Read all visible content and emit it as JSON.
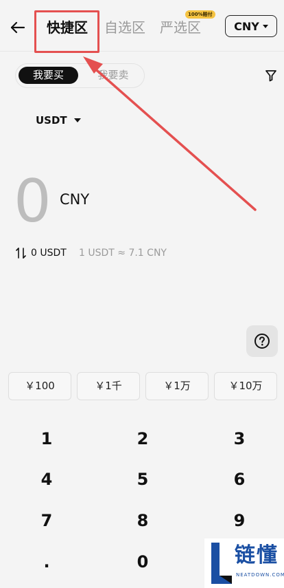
{
  "header": {
    "tabs": [
      {
        "label": "快捷区",
        "active": true
      },
      {
        "label": "自选区",
        "active": false
      },
      {
        "label": "严选区",
        "active": false,
        "badge": "100%赔付"
      }
    ],
    "currency": "CNY"
  },
  "trade_toggle": {
    "buy_label": "我要买",
    "sell_label": "我要卖",
    "selected": "buy"
  },
  "crypto": {
    "selected": "USDT"
  },
  "amount": {
    "value": "0",
    "unit": "CNY"
  },
  "conversion": {
    "converted": "0 USDT",
    "rate": "1 USDT ≈ 7.1 CNY"
  },
  "quick_amounts": [
    "￥100",
    "￥1千",
    "￥1万",
    "￥10万"
  ],
  "keypad": [
    "1",
    "2",
    "3",
    "4",
    "5",
    "6",
    "7",
    "8",
    "9",
    ".",
    "0"
  ],
  "watermark": {
    "title": "链懂",
    "subtitle": "NEATDOWN.COM"
  },
  "colors": {
    "background": "#f4f4f4",
    "annotation": "#e45050",
    "badge": "#f5c342",
    "watermark": "#1a4fa3"
  }
}
